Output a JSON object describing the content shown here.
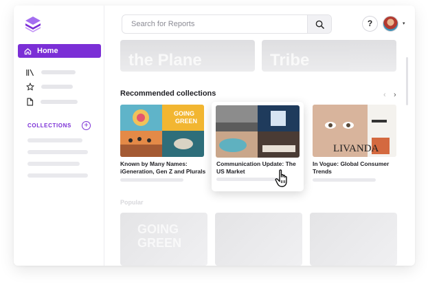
{
  "nav": {
    "home_label": "Home"
  },
  "sidebar": {
    "collections_label": "COLLECTIONS",
    "add_symbol": "+"
  },
  "search": {
    "placeholder": "Search for Reports"
  },
  "header": {
    "help_symbol": "?",
    "caret_symbol": "▾"
  },
  "banners": [
    {
      "text": "the Plane"
    },
    {
      "text": "Tribe"
    }
  ],
  "recommended": {
    "title": "Recommended collections",
    "prev_symbol": "‹",
    "next_symbol": "›",
    "items": [
      {
        "title": "Known by Many Names: iGeneration, Gen Z and Plurals",
        "tile_text": "GOING GREEN"
      },
      {
        "title": "Communication Update: The US Market"
      },
      {
        "title": "In Vogue: Global Consumer Trends",
        "tile_text": "LIVANDA"
      }
    ]
  },
  "popular": {
    "title": "Popular",
    "tile_text": "GOING GREEN"
  },
  "colors": {
    "accent": "#7b2fd6",
    "skeleton": "#e9e9ed"
  }
}
